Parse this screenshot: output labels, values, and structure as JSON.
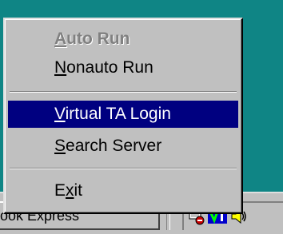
{
  "taskbar": {
    "task_button_label": "ook Express"
  },
  "tray": {
    "icons": [
      "network-icon",
      "virtual-ta-icon",
      "speaker-icon"
    ]
  },
  "menu": {
    "items": [
      {
        "mnemonic": "A",
        "rest": "uto Run",
        "state": "disabled"
      },
      {
        "mnemonic": "N",
        "rest": "onauto Run",
        "state": "normal"
      },
      {
        "mnemonic": "V",
        "rest": "irtual TA Login",
        "state": "selected"
      },
      {
        "mnemonic": "S",
        "rest": "earch Server",
        "state": "normal"
      },
      {
        "prefix": "E",
        "mnemonic": "x",
        "rest": "it",
        "state": "normal"
      }
    ]
  },
  "colors": {
    "desktop": "#0f8585",
    "menu_bg": "#c0c0c0",
    "highlight": "#000080"
  }
}
